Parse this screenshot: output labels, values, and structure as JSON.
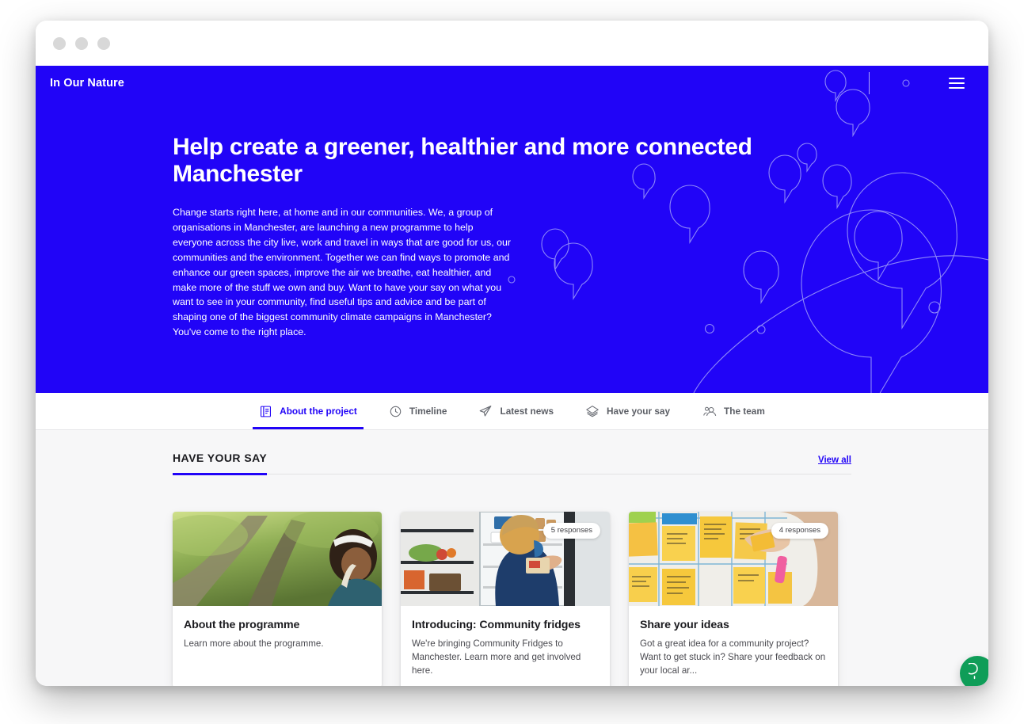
{
  "window": {
    "traffic_lights": [
      "close",
      "minimize",
      "maximize"
    ]
  },
  "header": {
    "brand": "In Our Nature",
    "menu_icon": "hamburger-icon"
  },
  "hero": {
    "title": "Help create a greener, healthier and more connected Manchester",
    "paragraph": "Change starts right here, at home and in our communities. We, a group of organisations in Manchester, are launching a new programme to help everyone across the city live, work and travel in ways that are good for us, our communities and the environment. Together we can find ways to promote and enhance our green spaces, improve the air we breathe, eat healthier, and make more of the stuff we own and buy. Want to have your say on what you want to see in your community, find useful tips and advice and be part of shaping one of the biggest community climate campaigns in Manchester? You've come to the right place.",
    "background_color": "#2104f7"
  },
  "tabs": [
    {
      "label": "About the project",
      "icon": "document-icon",
      "active": true
    },
    {
      "label": "Timeline",
      "icon": "clock-icon",
      "active": false
    },
    {
      "label": "Latest news",
      "icon": "paper-plane-icon",
      "active": false
    },
    {
      "label": "Have your say",
      "icon": "layers-icon",
      "active": false
    },
    {
      "label": "The team",
      "icon": "people-icon",
      "active": false
    }
  ],
  "section": {
    "title": "HAVE YOUR SAY",
    "view_all_label": "View all",
    "accent_color": "#2104f7"
  },
  "cards": [
    {
      "title": "About the programme",
      "description": "Learn more about the programme.",
      "badge": "",
      "image_alt": "woman-in-woodland-photo"
    },
    {
      "title": "Introducing: Community fridges",
      "description": "We're bringing Community Fridges to Manchester. Learn more and get involved here.",
      "badge": "5 responses",
      "image_alt": "person-stocking-community-fridge-photo"
    },
    {
      "title": "Share your ideas",
      "description": "Got a great idea for a community project? Want to get stuck in? Share your feedback on your local ar...",
      "badge": "4 responses",
      "image_alt": "sticky-notes-on-wall-photo"
    }
  ],
  "chat": {
    "icon": "chat-bubble-icon",
    "color": "#0f9d58"
  }
}
